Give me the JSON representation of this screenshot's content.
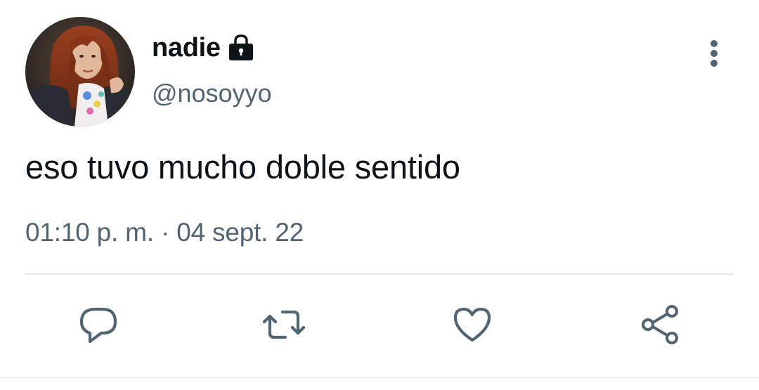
{
  "tweet": {
    "display_name": "nadie",
    "handle": "@nosoyyo",
    "text": "eso tuvo mucho doble sentido",
    "timestamp": "01:10 p. m. · 04 sept. 22",
    "protected_icon": "lock-icon"
  },
  "actions": [
    {
      "name": "reply",
      "icon": "comment-icon"
    },
    {
      "name": "retweet",
      "icon": "retweet-icon"
    },
    {
      "name": "like",
      "icon": "heart-icon"
    },
    {
      "name": "share",
      "icon": "share-icon"
    }
  ],
  "colors": {
    "text_primary": "#0f1419",
    "text_secondary": "#536471",
    "icon": "#536471",
    "divider": "#e5e8eb"
  }
}
